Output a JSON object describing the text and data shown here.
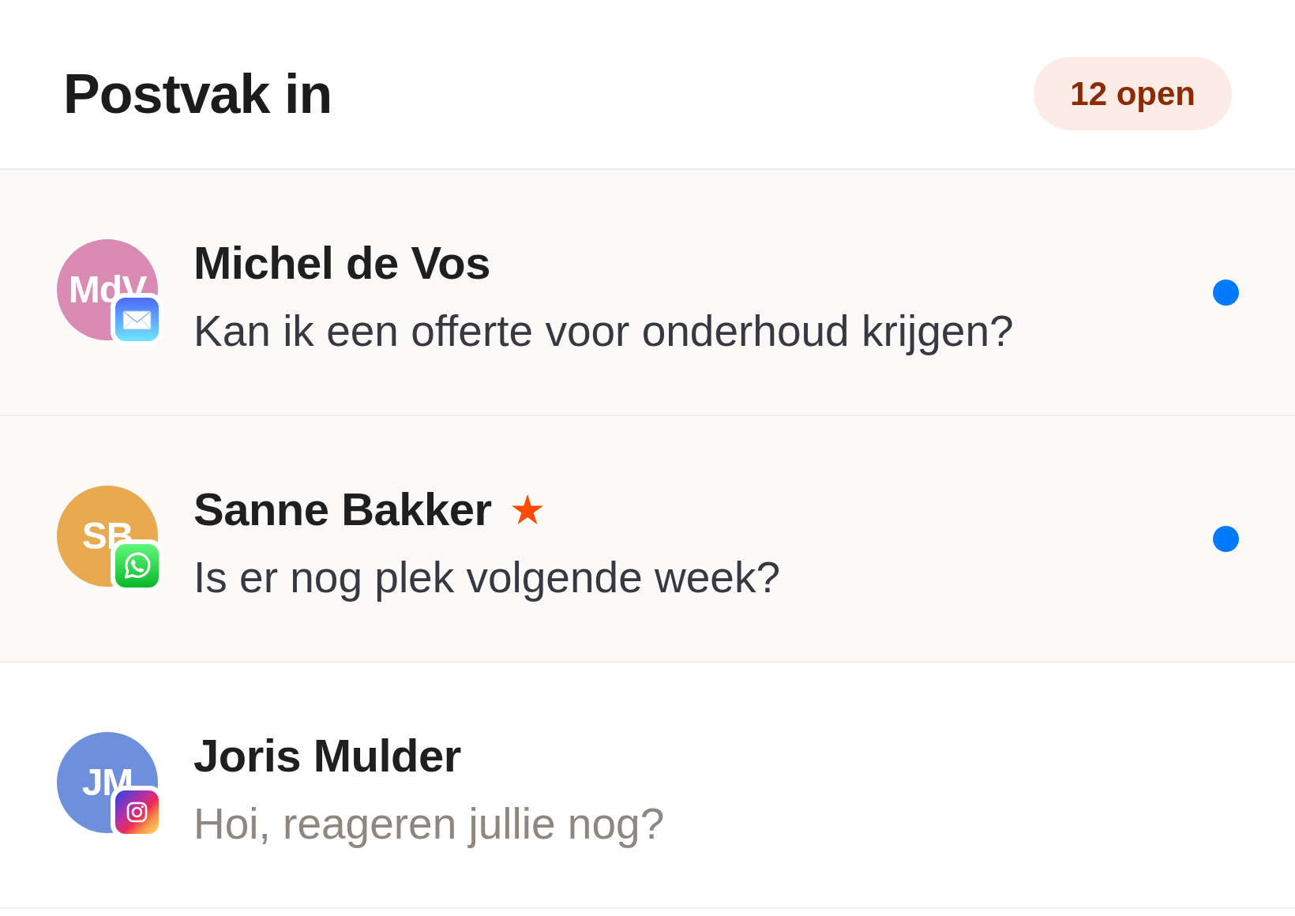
{
  "header": {
    "title": "Postvak in",
    "badge": "12 open"
  },
  "conversations": [
    {
      "initials": "MdV",
      "color": "#d98bb3",
      "kind": "email",
      "name": "Michel de Vos",
      "starred": false,
      "message": "Kan ik een offerte voor onderhoud krijgen?",
      "unread": true
    },
    {
      "initials": "SB",
      "color": "#e8a94f",
      "kind": "whatsapp",
      "name": "Sanne Bakker",
      "starred": true,
      "message": "Is er nog plek volgende week?",
      "unread": true
    },
    {
      "initials": "JM",
      "color": "#6d8fdc",
      "kind": "instagram",
      "name": "Joris Mulder",
      "starred": false,
      "message": "Hoi, reageren jullie nog?",
      "unread": false
    }
  ]
}
